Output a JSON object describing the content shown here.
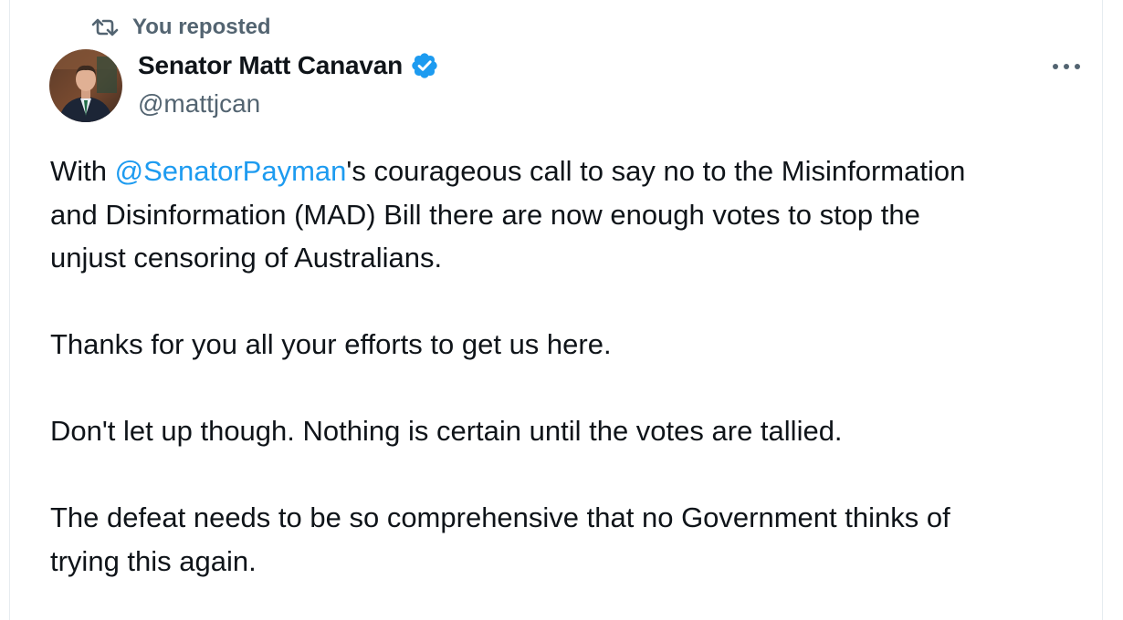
{
  "repost": {
    "icon": "repost-icon",
    "label": "You reposted"
  },
  "author": {
    "avatar_icon": "avatar",
    "display_name": "Senator Matt Canavan",
    "verified_icon": "verified-badge-icon",
    "verified_color": "#1d9bf0",
    "handle": "@mattjcan"
  },
  "more": {
    "icon": "more-horizontal-icon"
  },
  "tweet": {
    "p1": {
      "before": "With ",
      "mention": "@SenatorPayman",
      "line1_rest": "'s courageous call to say no to the Misinformation",
      "line2": "and Disinformation (MAD) Bill there are now enough votes to stop the",
      "line3": "unjust censoring of Australians."
    },
    "p2": "Thanks for you all your efforts to get us here.",
    "p3": "Don't let up though. Nothing is certain until the votes are tallied.",
    "p4": {
      "line1": "The defeat needs to be so comprehensive that no Government thinks of",
      "line2": "trying this again."
    }
  },
  "colors": {
    "text": "#0f1419",
    "secondary": "#536471",
    "link": "#1d9bf0"
  }
}
